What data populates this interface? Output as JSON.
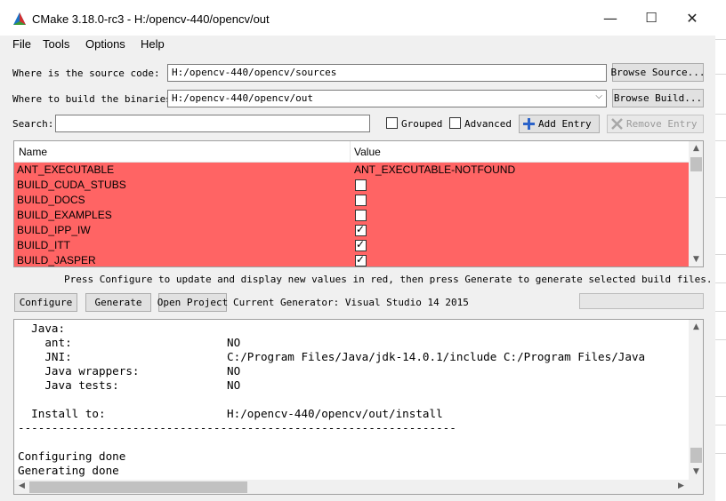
{
  "window": {
    "title": "CMake 3.18.0-rc3 - H:/opencv-440/opencv/out",
    "controls": {
      "minimize": "—",
      "maximize": "☐",
      "close": "✕"
    }
  },
  "menu": [
    {
      "label": "File"
    },
    {
      "label": "Tools"
    },
    {
      "label": "Options"
    },
    {
      "label": "Help"
    }
  ],
  "source": {
    "label": "Where is the source code:",
    "value": "H:/opencv-440/opencv/sources",
    "browse_label": "Browse Source..."
  },
  "build": {
    "label": "Where to build the binaries:",
    "value": "H:/opencv-440/opencv/out",
    "browse_label": "Browse Build..."
  },
  "search": {
    "label": "Search:",
    "value": "",
    "grouped_label": "Grouped",
    "grouped_checked": false,
    "advanced_label": "Advanced",
    "advanced_checked": false,
    "add_entry_label": "Add Entry",
    "remove_entry_label": "Remove Entry"
  },
  "table": {
    "columns": [
      "Name",
      "Value"
    ],
    "row_color": "#ff6464",
    "rows": [
      {
        "name": "ANT_EXECUTABLE",
        "type": "text",
        "value": "ANT_EXECUTABLE-NOTFOUND"
      },
      {
        "name": "BUILD_CUDA_STUBS",
        "type": "bool",
        "checked": false
      },
      {
        "name": "BUILD_DOCS",
        "type": "bool",
        "checked": false
      },
      {
        "name": "BUILD_EXAMPLES",
        "type": "bool",
        "checked": false
      },
      {
        "name": "BUILD_IPP_IW",
        "type": "bool",
        "checked": true
      },
      {
        "name": "BUILD_ITT",
        "type": "bool",
        "checked": true
      },
      {
        "name": "BUILD_JASPER",
        "type": "bool",
        "checked": true
      }
    ]
  },
  "hint": "Press Configure to update and display new values in red, then press Generate to generate selected build files.",
  "actions": {
    "configure_label": "Configure",
    "generate_label": "Generate",
    "open_project_label": "Open Project",
    "generator_text": "Current Generator: Visual Studio 14 2015"
  },
  "output": {
    "lines": [
      "  Java:",
      "    ant:                       NO",
      "    JNI:                       C:/Program Files/Java/jdk-14.0.1/include C:/Program Files/Java",
      "    Java wrappers:             NO",
      "    Java tests:                NO",
      "",
      "  Install to:                  H:/opencv-440/opencv/out/install",
      "-----------------------------------------------------------------",
      "",
      "Configuring done",
      "Generating done"
    ]
  }
}
